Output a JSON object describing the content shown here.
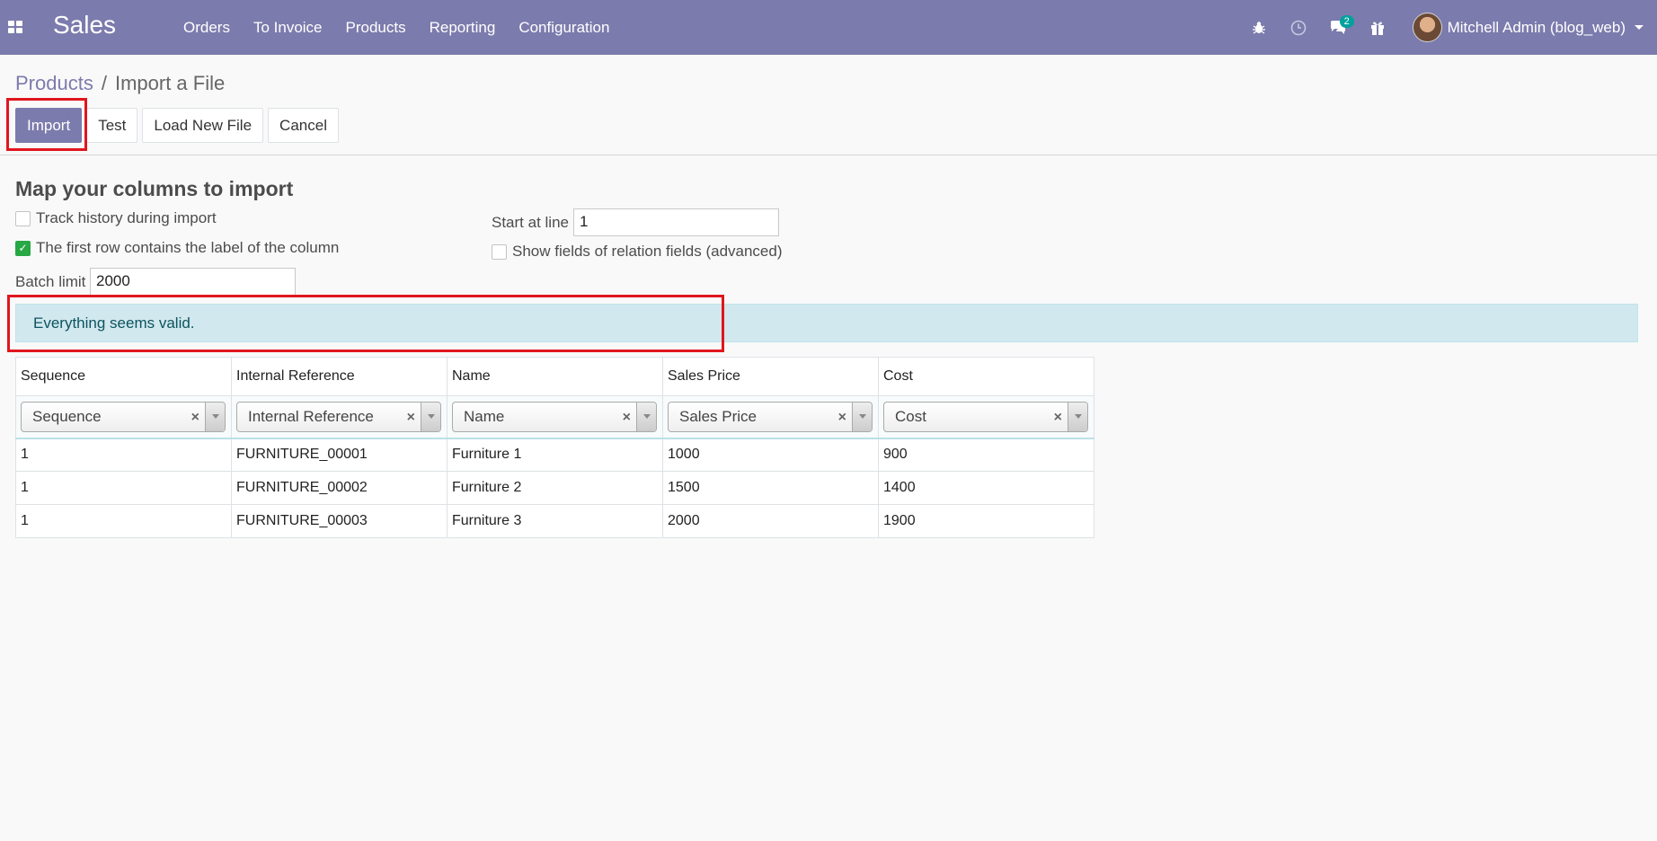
{
  "navbar": {
    "app_title": "Sales",
    "menu": [
      "Orders",
      "To Invoice",
      "Products",
      "Reporting",
      "Configuration"
    ],
    "messages_count": "2",
    "user_name": "Mitchell Admin (blog_web)",
    "colors": {
      "navbar": "#7c7bad",
      "badge": "#00a09d"
    }
  },
  "breadcrumb": {
    "parent": "Products",
    "separator": "/",
    "current": "Import a File"
  },
  "buttons": {
    "import": "Import",
    "test": "Test",
    "load_new_file": "Load New File",
    "cancel": "Cancel"
  },
  "form": {
    "title": "Map your columns to import",
    "track_history_label": "Track history during import",
    "track_history_checked": false,
    "first_row_label": "The first row contains the label of the column",
    "first_row_checked": true,
    "batch_limit_label": "Batch limit",
    "batch_limit_value": "2000",
    "start_line_label": "Start at line",
    "start_line_value": "1",
    "show_relations_label": "Show fields of relation fields (advanced)",
    "show_relations_checked": false
  },
  "alert": {
    "message": "Everything seems valid."
  },
  "table": {
    "headers": [
      "Sequence",
      "Internal Reference",
      "Name",
      "Sales Price",
      "Cost"
    ],
    "mappings": [
      "Sequence",
      "Internal Reference",
      "Name",
      "Sales Price",
      "Cost"
    ],
    "rows": [
      [
        "1",
        "FURNITURE_00001",
        "Furniture 1",
        "1000",
        "900"
      ],
      [
        "1",
        "FURNITURE_00002",
        "Furniture 2",
        "1500",
        "1400"
      ],
      [
        "1",
        "FURNITURE_00003",
        "Furniture 3",
        "2000",
        "1900"
      ]
    ]
  }
}
